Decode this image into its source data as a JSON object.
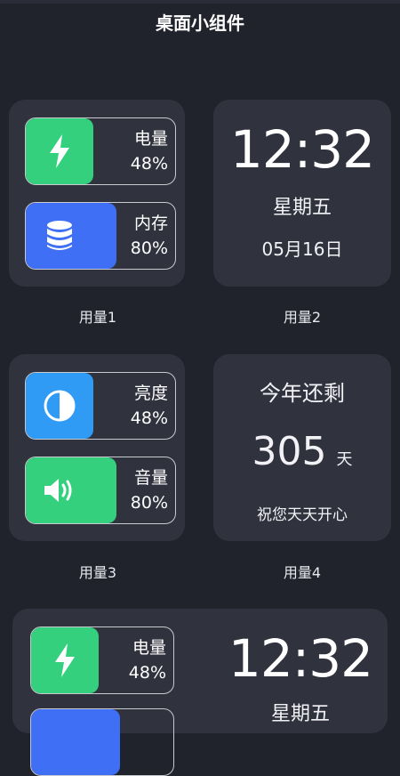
{
  "header": {
    "title": "桌面小组件"
  },
  "widgets": {
    "w1": {
      "caption": "用量1",
      "rows": [
        {
          "label": "电量",
          "value": "48%",
          "icon": "lightning-icon",
          "color": "#34d07e",
          "level": 0.48
        },
        {
          "label": "内存",
          "value": "80%",
          "icon": "database-icon",
          "color": "#3f6ff5",
          "level": 0.8
        }
      ]
    },
    "w2": {
      "caption": "用量2",
      "time": "12:32",
      "weekday": "星期五",
      "date": "05月16日"
    },
    "w3": {
      "caption": "用量3",
      "rows": [
        {
          "label": "亮度",
          "value": "48%",
          "icon": "brightness-icon",
          "color": "#2f9bf5",
          "level": 0.48
        },
        {
          "label": "音量",
          "value": "80%",
          "icon": "speaker-icon",
          "color": "#34d07e",
          "level": 0.8
        }
      ]
    },
    "w4": {
      "caption": "用量4",
      "title": "今年还剩",
      "days": "305",
      "unit": "天",
      "note": "祝您天天开心"
    },
    "w5": {
      "rows": [
        {
          "label": "电量",
          "value": "48%",
          "icon": "lightning-icon",
          "color": "#34d07e",
          "level": 0.48
        }
      ],
      "time": "12:32",
      "weekday": "星期五"
    }
  }
}
